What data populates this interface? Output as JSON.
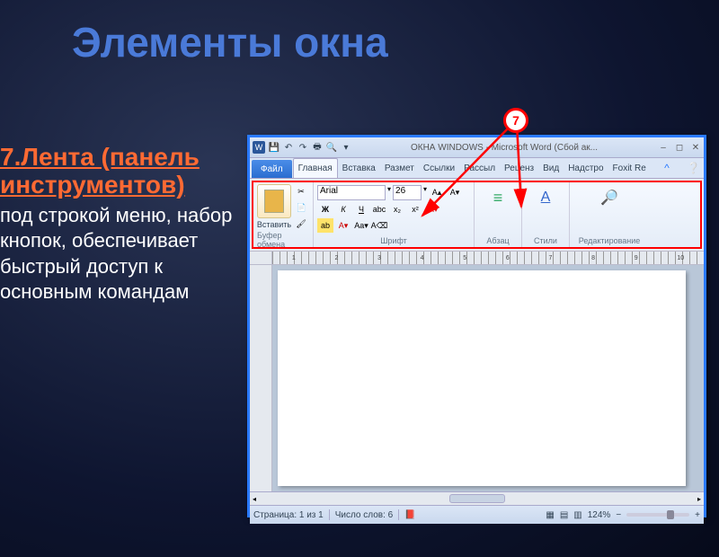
{
  "slide": {
    "title": "Элементы окна",
    "callout_number": "7",
    "heading": "7.Лента (панель инструментов)",
    "description": "под строкой меню, набор кнопок, обеспечивает быстрый доступ к основным командам"
  },
  "titlebar": {
    "app_icon": "W",
    "doc_title": "ОКНА WINDOWS - Microsoft Word (Сбой ак..."
  },
  "tabs": {
    "file": "Файл",
    "items": [
      "Главная",
      "Вставка",
      "Размет",
      "Ссылки",
      "Рассыл",
      "Реценз",
      "Вид",
      "Надстро",
      "Foxit Re"
    ]
  },
  "ribbon": {
    "clipboard": {
      "paste": "Вставить",
      "label": "Буфер обмена"
    },
    "font": {
      "name": "Arial",
      "size": "26",
      "label": "Шрифт",
      "bold": "Ж",
      "italic": "К",
      "underline": "Ч"
    },
    "paragraph": {
      "label": "Абзац"
    },
    "styles": {
      "label": "Стили"
    },
    "editing": {
      "label": "Редактирование"
    }
  },
  "ruler_numbers": [
    "",
    "1",
    "2",
    "3",
    "4",
    "5",
    "6",
    "7",
    "8",
    "9",
    "10"
  ],
  "status": {
    "page": "Страница: 1 из 1",
    "words": "Число слов: 6",
    "zoom": "124%"
  }
}
